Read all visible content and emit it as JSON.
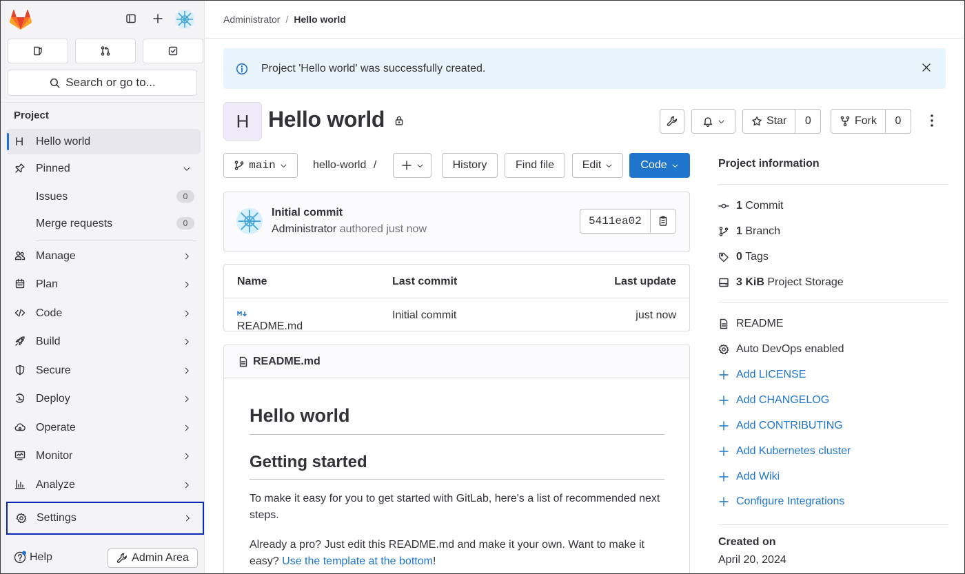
{
  "breadcrumb": {
    "parent": "Administrator",
    "separator": "/",
    "current": "Hello world"
  },
  "sidebar": {
    "search_label": "Search or go to...",
    "section_title": "Project",
    "project_item": {
      "letter": "H",
      "label": "Hello world"
    },
    "pinned": {
      "label": "Pinned",
      "items": [
        {
          "label": "Issues",
          "count": "0"
        },
        {
          "label": "Merge requests",
          "count": "0"
        }
      ]
    },
    "nav": [
      {
        "label": "Manage",
        "icon": "users-icon"
      },
      {
        "label": "Plan",
        "icon": "calendar-icon"
      },
      {
        "label": "Code",
        "icon": "code-icon"
      },
      {
        "label": "Build",
        "icon": "rocket-icon"
      },
      {
        "label": "Secure",
        "icon": "shield-icon"
      },
      {
        "label": "Deploy",
        "icon": "deploy-icon"
      },
      {
        "label": "Operate",
        "icon": "cloud-icon"
      },
      {
        "label": "Monitor",
        "icon": "monitor-icon"
      },
      {
        "label": "Analyze",
        "icon": "chart-icon"
      }
    ],
    "settings_label": "Settings",
    "help_label": "Help",
    "admin_label": "Admin Area"
  },
  "alert": {
    "text": "Project 'Hello world' was successfully created."
  },
  "project": {
    "avatar_letter": "H",
    "title": "Hello world",
    "star_label": "Star",
    "star_count": "0",
    "fork_label": "Fork",
    "fork_count": "0"
  },
  "repo_toolbar": {
    "branch": "main",
    "path": "hello-world",
    "path_sep": "/",
    "history_label": "History",
    "find_file_label": "Find file",
    "edit_label": "Edit",
    "code_label": "Code"
  },
  "commit": {
    "title": "Initial commit",
    "author": "Administrator",
    "meta": "authored just now",
    "sha": "5411ea02"
  },
  "files": {
    "headers": [
      "Name",
      "Last commit",
      "Last update"
    ],
    "rows": [
      {
        "name": "README.md",
        "commit": "Initial commit",
        "updated": "just now"
      }
    ]
  },
  "readme": {
    "filename": "README.md",
    "h1": "Hello world",
    "h2": "Getting started",
    "p1": "To make it easy for you to get started with GitLab, here's a list of recommended next steps.",
    "p2_start": "Already a pro? Just edit this README.md and make it your own. Want to make it easy? ",
    "p2_link": "Use the template at the bottom",
    "p2_end": "!"
  },
  "project_info": {
    "title": "Project information",
    "stats": [
      {
        "count": "1",
        "label": "Commit",
        "icon": "commit-icon"
      },
      {
        "count": "1",
        "label": "Branch",
        "icon": "branch-icon"
      },
      {
        "count": "0",
        "label": "Tags",
        "icon": "tag-icon"
      },
      {
        "count": "3 KiB",
        "label": "Project Storage",
        "icon": "storage-icon"
      }
    ],
    "readme_label": "README",
    "autodevops_label": "Auto DevOps enabled",
    "links": [
      "Add LICENSE",
      "Add CHANGELOG",
      "Add CONTRIBUTING",
      "Add Kubernetes cluster",
      "Add Wiki",
      "Configure Integrations"
    ],
    "created_label": "Created on",
    "created_date": "April 20, 2024"
  },
  "colors": {
    "accent": "#1f75cb",
    "sidebar_bg": "#f4f4f6",
    "alert_bg": "#e9f3fc",
    "settings_outline": "#0a27b8",
    "gitlab_orange": "#fc6d26"
  }
}
